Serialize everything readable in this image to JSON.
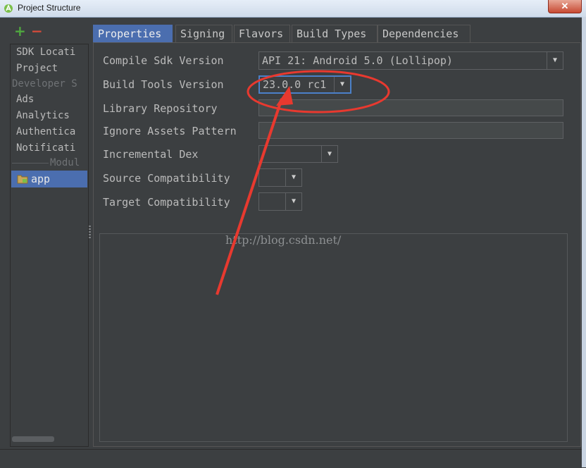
{
  "window": {
    "title": "Project Structure",
    "close_label": "✕"
  },
  "toolbar": {
    "add_label": "+",
    "remove_label": "−"
  },
  "sidebar": {
    "items": [
      {
        "label": "SDK Locati"
      },
      {
        "label": "Project"
      },
      {
        "label": "Developer S"
      },
      {
        "label": "Ads"
      },
      {
        "label": "Analytics"
      },
      {
        "label": "Authentica"
      },
      {
        "label": "Notificati"
      },
      {
        "label": "Modul"
      },
      {
        "label": "app"
      }
    ]
  },
  "tabs": [
    {
      "label": "Properties"
    },
    {
      "label": "Signing"
    },
    {
      "label": "Flavors"
    },
    {
      "label": "Build Types"
    },
    {
      "label": "Dependencies"
    }
  ],
  "form": {
    "compile_sdk": {
      "label": "Compile Sdk Version",
      "value": "API 21: Android 5.0 (Lollipop)"
    },
    "build_tools": {
      "label": "Build Tools Version",
      "value": "23.0.0 rc1"
    },
    "library_repository": {
      "label": "Library Repository",
      "value": ""
    },
    "ignore_assets": {
      "label": "Ignore Assets Pattern",
      "value": ""
    },
    "incremental_dex": {
      "label": "Incremental Dex",
      "value": ""
    },
    "source_compat": {
      "label": "Source Compatibility",
      "value": ""
    },
    "target_compat": {
      "label": "Target Compatibility",
      "value": ""
    }
  },
  "watermark": "http://blog.csdn.net/",
  "colors": {
    "accent": "#4b6eaf",
    "annotation": "#e8392f",
    "background": "#3c3f41"
  }
}
